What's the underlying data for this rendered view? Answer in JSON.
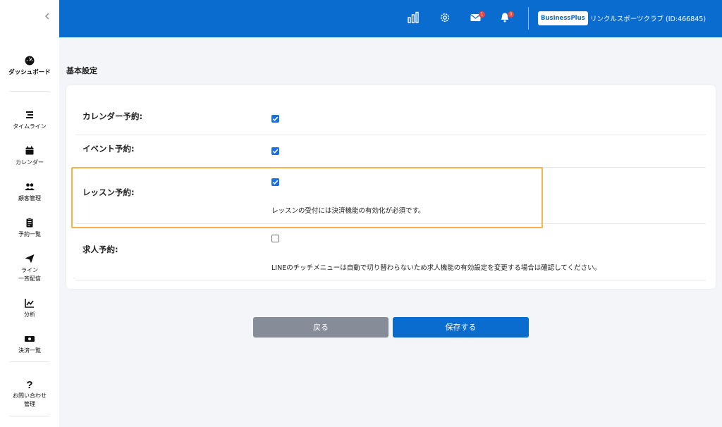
{
  "sidebar": {
    "collapse_icon": "chevron-left-icon",
    "items": [
      {
        "label": "ダッシュボード",
        "icon": "speedometer-icon"
      },
      {
        "label": "タイムライン",
        "icon": "list-lines-icon"
      },
      {
        "label": "カレンダー",
        "icon": "calendar-icon"
      },
      {
        "label": "顧客管理",
        "icon": "users-icon"
      },
      {
        "label": "予約一覧",
        "icon": "clipboard-icon"
      },
      {
        "label_line1": "ライン",
        "label_line2": "一斉配信",
        "icon": "send-icon"
      },
      {
        "label": "分析",
        "icon": "chart-line-icon"
      },
      {
        "label": "決済一覧",
        "icon": "money-icon"
      },
      {
        "label_line1": "お問い合わせ",
        "label_line2": "管理",
        "icon": "question-icon"
      }
    ]
  },
  "header": {
    "background": "#0a6ccf",
    "icons": [
      "bar-chart-icon",
      "gear-icon",
      "mail-icon",
      "bell-icon"
    ],
    "mail_badge": "1",
    "bell_badge": "0",
    "plan": "BusinessPlus",
    "club_name": "リンクルスポーツクラブ (ID:466845)"
  },
  "main": {
    "title": "基本設定",
    "rows": [
      {
        "label": "カレンダー予約:",
        "checked": true,
        "note": ""
      },
      {
        "label": "イベント予約:",
        "checked": true,
        "note": ""
      },
      {
        "label": "レッスン予約:",
        "checked": true,
        "note": "レッスンの受付には決済機能の有効化が必須です。",
        "highlighted": true
      },
      {
        "label": "求人予約:",
        "checked": false,
        "note": "LINEのチッチメニューは自動で切り替わらないため求人機能の有効設定を変更する場合は確認してください。"
      }
    ],
    "highlight_color": "#f5b24f"
  },
  "buttons": {
    "back": "戻る",
    "save": "保存する",
    "back_color": "#878c99",
    "save_color": "#0a6ccf"
  }
}
